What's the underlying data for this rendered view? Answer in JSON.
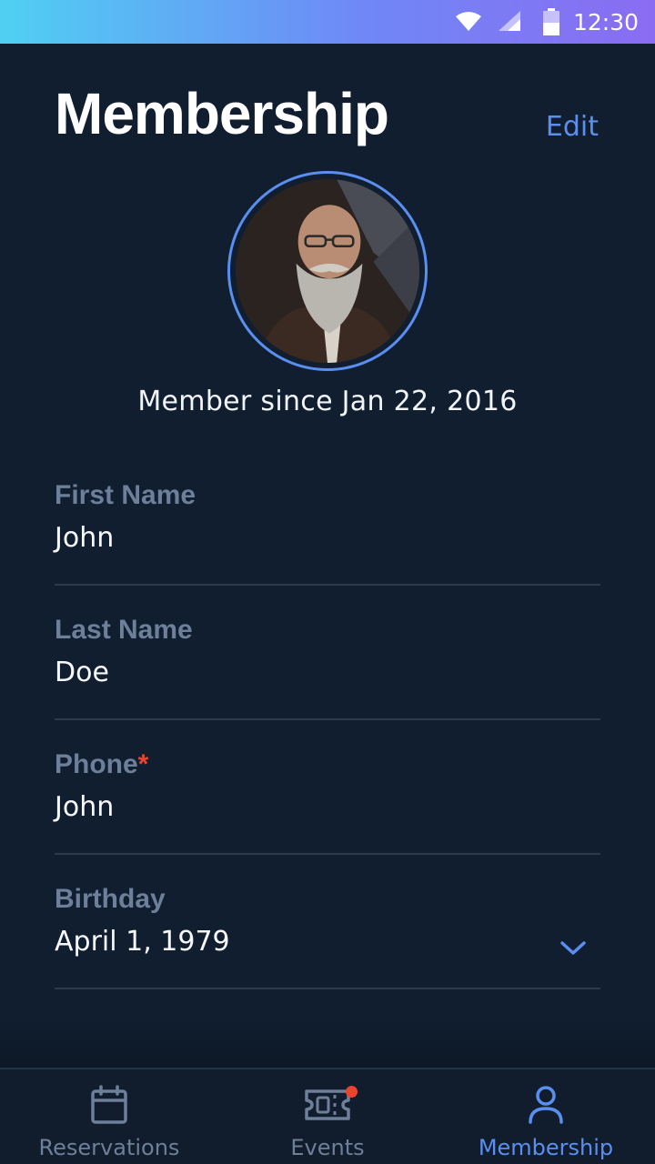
{
  "status_bar": {
    "time": "12:30",
    "icons": [
      "wifi-icon",
      "signal-icon",
      "battery-icon"
    ]
  },
  "header": {
    "title": "Membership",
    "edit_label": "Edit"
  },
  "profile": {
    "member_since": "Member since Jan 22, 2016"
  },
  "fields": [
    {
      "label": "First Name",
      "value": "John",
      "required": false
    },
    {
      "label": "Last Name",
      "value": "Doe",
      "required": false
    },
    {
      "label": "Phone",
      "required_mark": "*",
      "value": "John",
      "required": true
    },
    {
      "label": "Birthday",
      "value": "April 1, 1979",
      "type": "dropdown"
    }
  ],
  "tabs": [
    {
      "label": "Reservations",
      "icon": "calendar-icon",
      "active": false
    },
    {
      "label": "Events",
      "icon": "ticket-icon",
      "active": false,
      "has_notification": true
    },
    {
      "label": "Membership",
      "icon": "person-icon",
      "active": true
    }
  ],
  "colors": {
    "background": "#101e2f",
    "accent": "#5b8fef",
    "label": "#6d7f99",
    "required": "#e8442f"
  }
}
